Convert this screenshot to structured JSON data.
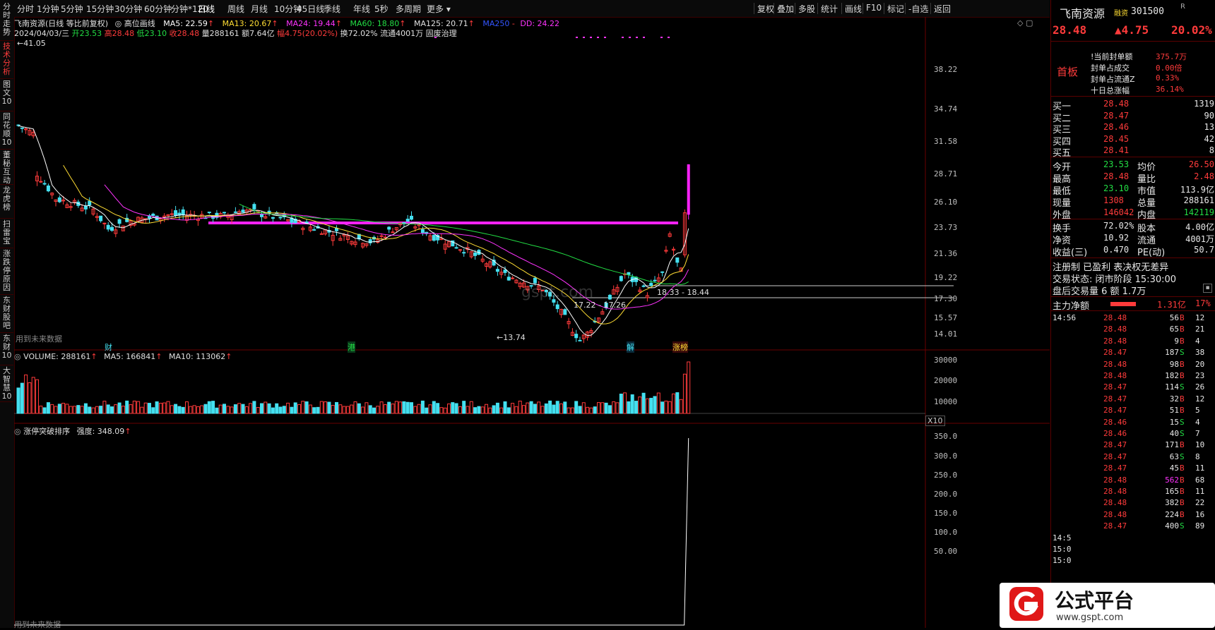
{
  "left_tabs": [
    "分时走势",
    "技术分析",
    "图文10",
    "同花顺10",
    "董秘互动",
    "龙虎榜",
    "扫雷宝",
    "涨跌停原因",
    "东财股吧",
    "东财10",
    "大智慧10"
  ],
  "period_tabs": [
    "分时",
    "1分钟",
    "5分钟",
    "15分钟",
    "30分钟",
    "60分钟",
    "分钟*120",
    "日线",
    "周线",
    "月线",
    "10分钟",
    "45日线",
    "季线",
    "年线",
    "5秒",
    "多周期",
    "更多"
  ],
  "period_selected": "日线",
  "toolbar_right": [
    "复权",
    "叠加",
    "多股",
    "统计",
    "画线",
    "F10",
    "标记",
    "-自选",
    "返回"
  ],
  "header": {
    "line1_name": "飞南资源(日线 等比前复权)",
    "line1_indicator": "高位画线",
    "ma5": "MA5: 22.59",
    "ma13": "MA13: 20.67",
    "ma24": "MA24: 19.44",
    "ma60": "MA60: 18.80",
    "ma125": "MA125: 20.71",
    "ma250": "MA250",
    "dd": "DD: 24.22",
    "date": "2024/04/03/三",
    "open": "开23.53",
    "high": "高28.48",
    "low": "低23.10",
    "close": "收28.48",
    "vol": "量288161",
    "amount": "额7.64亿",
    "amp": "幅4.75(20.02%)",
    "turn": "换72.02%",
    "float": "流通4001万",
    "concept": "固废治理"
  },
  "price_axis": [
    "38.22",
    "34.74",
    "31.58",
    "28.71",
    "26.10",
    "23.73",
    "21.36",
    "19.22",
    "17.30",
    "15.57",
    "14.01"
  ],
  "chart_labels": {
    "top_price": "41.05",
    "low_price": "13.74",
    "range1": "17.22 - 17.26",
    "range2": "18.33 - 18.44",
    "future": "用到未来数据",
    "marker_cai": "财",
    "marker_gang": "港",
    "marker_jie": "解",
    "marker_zhangbang": "涨榜"
  },
  "volume": {
    "title": "VOLUME: 288161",
    "ma5": "MA5: 166841",
    "ma10": "MA10: 113062",
    "axis": [
      "30000",
      "20000",
      "10000"
    ],
    "unit": "X10"
  },
  "indicator": {
    "title": "涨停突破排序",
    "strength": "强度: 348.09",
    "axis": [
      "350.0",
      "300.0",
      "250.0",
      "200.0",
      "150.0",
      "100.0",
      "50.00"
    ],
    "future": "用到未来数据"
  },
  "quote": {
    "name": "飞南资源",
    "tag": "融资",
    "code": "301500",
    "flag": "R",
    "price": "28.48",
    "change": "▲4.75",
    "pct": "20.02%",
    "board": "首板",
    "seal_rows": [
      {
        "label": "!当前封单额",
        "value": "375.7万"
      },
      {
        "label": "封单占成交",
        "value": "0.00倍"
      },
      {
        "label": "封单占流通Z",
        "value": "0.33%"
      },
      {
        "label": "十日总涨幅",
        "value": "36.14%"
      }
    ],
    "bids": [
      {
        "label": "买一",
        "price": "28.48",
        "vol": "1319"
      },
      {
        "label": "买二",
        "price": "28.47",
        "vol": "90"
      },
      {
        "label": "买三",
        "price": "28.46",
        "vol": "13"
      },
      {
        "label": "买四",
        "price": "28.45",
        "vol": "42"
      },
      {
        "label": "买五",
        "price": "28.41",
        "vol": "8"
      }
    ],
    "stats": [
      {
        "l1": "今开",
        "v1": "23.53",
        "c1": "grn",
        "l2": "均价",
        "v2": "26.50",
        "c2": "red"
      },
      {
        "l1": "最高",
        "v1": "28.48",
        "c1": "red",
        "l2": "量比",
        "v2": "2.48",
        "c2": "red"
      },
      {
        "l1": "最低",
        "v1": "23.10",
        "c1": "grn",
        "l2": "市值",
        "v2": "113.9亿",
        "c2": "wht"
      },
      {
        "l1": "现量",
        "v1": "1308",
        "c1": "red",
        "l2": "总量",
        "v2": "288161",
        "c2": "wht"
      },
      {
        "l1": "外盘",
        "v1": "146042",
        "c1": "red",
        "l2": "内盘",
        "v2": "142119",
        "c2": "grn"
      }
    ],
    "stats2": [
      {
        "l1": "换手",
        "v1": "72.02%",
        "l2": "股本",
        "v2": "4.00亿"
      },
      {
        "l1": "净资",
        "v1": "10.92",
        "l2": "流通",
        "v2": "4001万"
      },
      {
        "l1": "收益(三)",
        "v1": "0.470",
        "l2": "PE(动)",
        "v2": "50.7"
      }
    ],
    "reg": "注册制 已盈利 表决权无差异",
    "trade_status": "交易状态: 闭市阶段 15:30:00",
    "after": "盘后交易量 6 额 1.7万",
    "main_flow_label": "主力净额",
    "main_flow_val": "1.31亿",
    "main_flow_pct": "17%",
    "ticks": [
      {
        "t": "14:56",
        "p": "28.48",
        "v": "56",
        "bs": "B",
        "n": "12"
      },
      {
        "t": "",
        "p": "28.48",
        "v": "65",
        "bs": "B",
        "n": "21"
      },
      {
        "t": "",
        "p": "28.48",
        "v": "9",
        "bs": "B",
        "n": "4"
      },
      {
        "t": "",
        "p": "28.47",
        "v": "187",
        "bs": "S",
        "n": "38"
      },
      {
        "t": "",
        "p": "28.48",
        "v": "98",
        "bs": "B",
        "n": "20"
      },
      {
        "t": "",
        "p": "28.48",
        "v": "182",
        "bs": "B",
        "n": "23"
      },
      {
        "t": "",
        "p": "28.47",
        "v": "114",
        "bs": "S",
        "n": "26"
      },
      {
        "t": "",
        "p": "28.47",
        "v": "32",
        "bs": "B",
        "n": "12"
      },
      {
        "t": "",
        "p": "28.47",
        "v": "51",
        "bs": "B",
        "n": "5"
      },
      {
        "t": "",
        "p": "28.46",
        "v": "15",
        "bs": "S",
        "n": "4"
      },
      {
        "t": "",
        "p": "28.46",
        "v": "40",
        "bs": "S",
        "n": "7"
      },
      {
        "t": "",
        "p": "28.47",
        "v": "171",
        "bs": "B",
        "n": "10"
      },
      {
        "t": "",
        "p": "28.47",
        "v": "63",
        "bs": "S",
        "n": "8"
      },
      {
        "t": "",
        "p": "28.47",
        "v": "45",
        "bs": "B",
        "n": "11"
      },
      {
        "t": "",
        "p": "28.48",
        "v": "562",
        "bs": "B",
        "n": "68"
      },
      {
        "t": "",
        "p": "28.48",
        "v": "165",
        "bs": "B",
        "n": "11"
      },
      {
        "t": "",
        "p": "28.48",
        "v": "382",
        "bs": "B",
        "n": "22"
      },
      {
        "t": "",
        "p": "28.48",
        "v": "224",
        "bs": "B",
        "n": "16"
      },
      {
        "t": "",
        "p": "28.47",
        "v": "400",
        "bs": "S",
        "n": "89"
      },
      {
        "t": "14:5",
        "p": "",
        "v": "",
        "bs": "",
        "n": ""
      },
      {
        "t": "15:0",
        "p": "",
        "v": "",
        "bs": "",
        "n": ""
      },
      {
        "t": "15:0",
        "p": "",
        "v": "",
        "bs": "",
        "n": ""
      }
    ]
  },
  "watermark": {
    "title": "公式平台",
    "url": "www.gspt.com",
    "center": "gspt.com"
  },
  "colors": {
    "up": "#ff3b3b",
    "down": "#44e0f0",
    "ma5": "#ffffff",
    "ma13": "#ffdd33",
    "ma24": "#ff33ff",
    "ma60": "#22dd44",
    "limit_line": "#ff22ff"
  }
}
